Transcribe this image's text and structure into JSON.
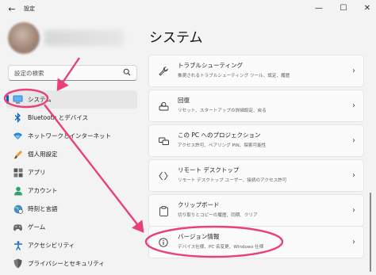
{
  "window": {
    "back_glyph": "←",
    "title": "設定",
    "minimize_glyph": "—",
    "maximize_glyph": "☐",
    "close_glyph": "✕"
  },
  "search": {
    "placeholder": "設定の検索",
    "icon": "search-icon"
  },
  "sidebar": {
    "items": [
      {
        "label": "システム",
        "icon": "monitor-icon",
        "selected": true
      },
      {
        "label": "Bluetooth とデバイス",
        "icon": "bluetooth-icon"
      },
      {
        "label": "ネットワークとインターネット",
        "icon": "wifi-icon"
      },
      {
        "label": "個人用設定",
        "icon": "brush-icon"
      },
      {
        "label": "アプリ",
        "icon": "apps-icon"
      },
      {
        "label": "アカウント",
        "icon": "account-icon"
      },
      {
        "label": "時刻と言語",
        "icon": "globe-clock-icon"
      },
      {
        "label": "ゲーム",
        "icon": "gamepad-icon"
      },
      {
        "label": "アクセシビリティ",
        "icon": "accessibility-icon"
      },
      {
        "label": "プライバシーとセキュリティ",
        "icon": "shield-icon"
      }
    ]
  },
  "main": {
    "title": "システム",
    "cards": [
      {
        "title": "トラブルシューティング",
        "subtitle": "推奨されるトラブルシューティング ツール、設定、履歴",
        "icon": "wrench-icon"
      },
      {
        "title": "回復",
        "subtitle": "リセット、スタートアップの詳細設定、戻る",
        "icon": "recovery-icon"
      },
      {
        "title": "この PC へのプロジェクション",
        "subtitle": "アクセス許可、ペアリング PIN、探索可能性",
        "icon": "projection-icon"
      },
      {
        "title": "リモート デスクトップ",
        "subtitle": "リモート デスクトップ ユーザー、接続のアクセス許可",
        "icon": "remote-desktop-icon"
      },
      {
        "title": "クリップボード",
        "subtitle": "切り取りとコピーの履歴、同期、クリア",
        "icon": "clipboard-icon"
      },
      {
        "title": "バージョン情報",
        "subtitle": "デバイス仕様、PC 名変更、Windows 仕様",
        "icon": "info-icon"
      }
    ],
    "chevron": "›"
  },
  "annotation": {
    "color": "#e8407a"
  }
}
